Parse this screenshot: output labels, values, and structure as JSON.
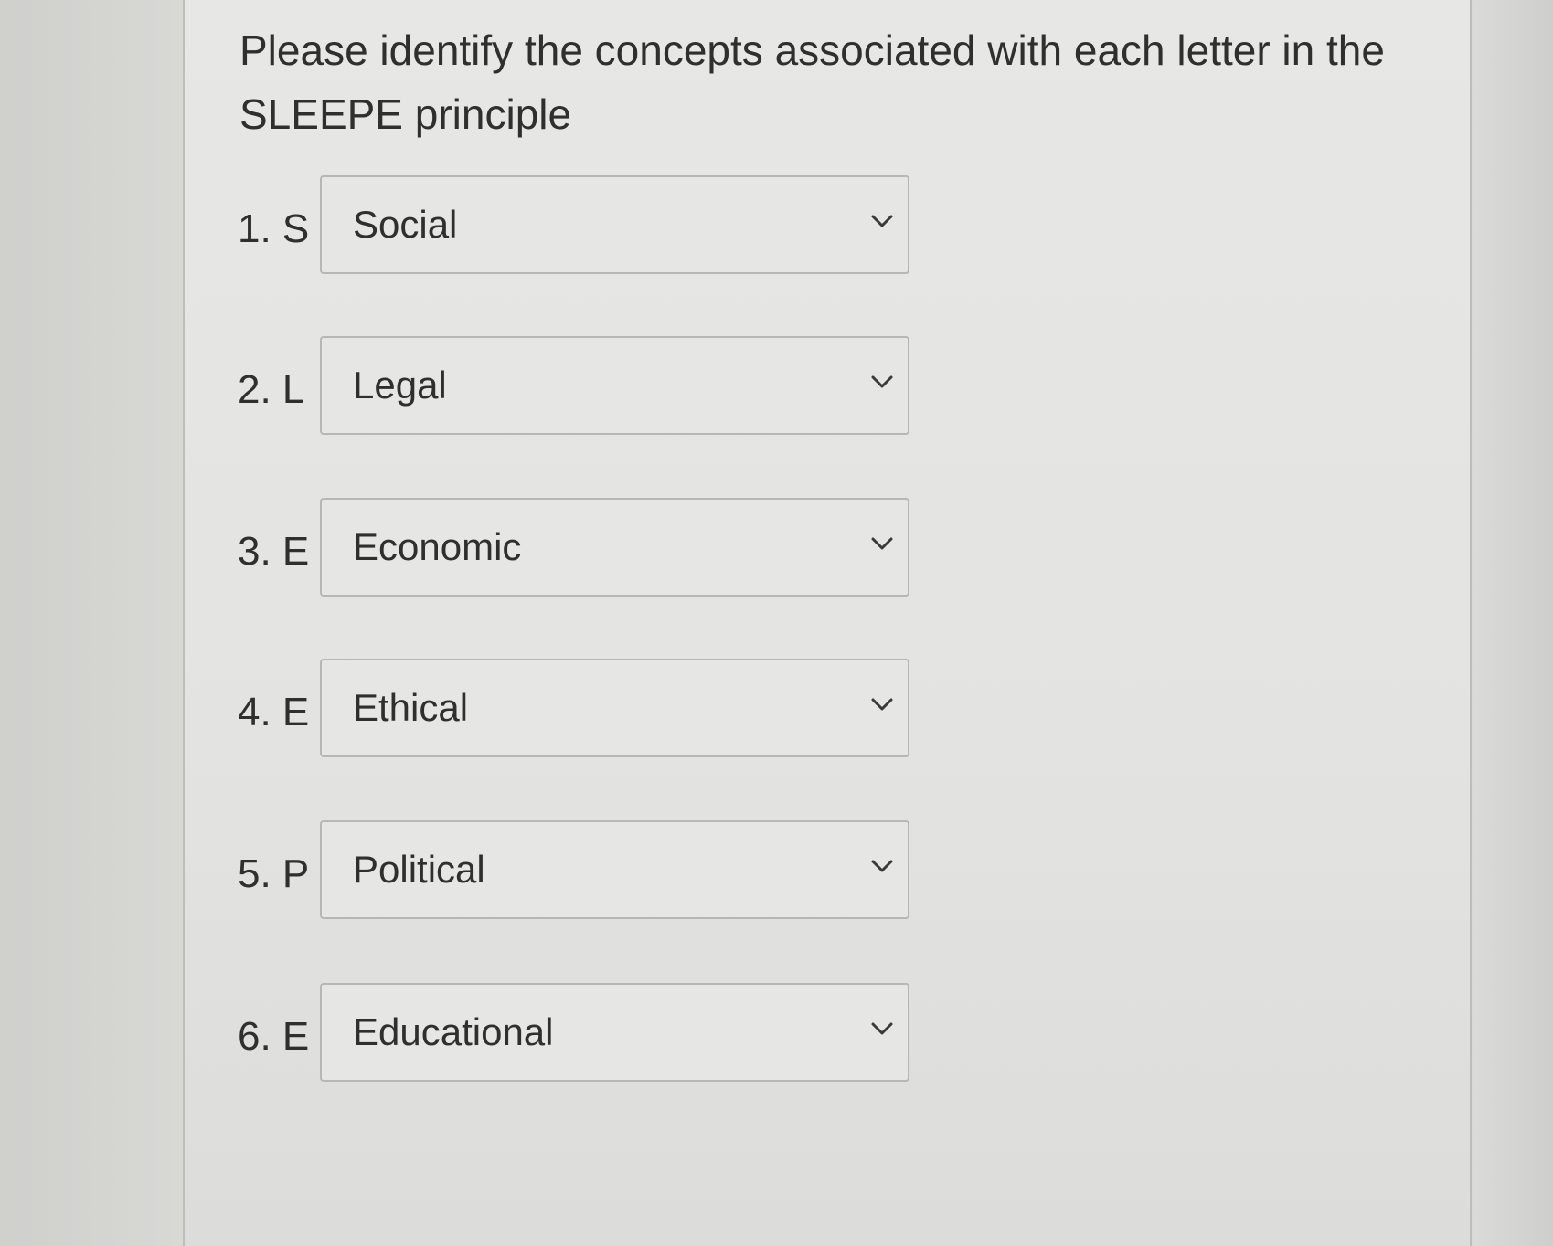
{
  "question": {
    "text_line1": "Please identify the concepts associated with each letter in the",
    "text_line2": "SLEEPE principle"
  },
  "rows": [
    {
      "label": "1. S",
      "selected": "Social",
      "icon": "chevron-down-icon"
    },
    {
      "label": "2. L",
      "selected": "Legal",
      "icon": "chevron-down-icon"
    },
    {
      "label": "3. E",
      "selected": "Economic",
      "icon": "chevron-down-icon"
    },
    {
      "label": "4. E",
      "selected": "Ethical",
      "icon": "chevron-down-icon"
    },
    {
      "label": "5. P",
      "selected": "Political",
      "icon": "chevron-down-icon"
    },
    {
      "label": "6. E",
      "selected": "Educational",
      "icon": "chevron-down-icon"
    }
  ],
  "colors": {
    "background": "#e4e4e2",
    "border": "#b7b7b4",
    "text": "#2f2f2f"
  }
}
